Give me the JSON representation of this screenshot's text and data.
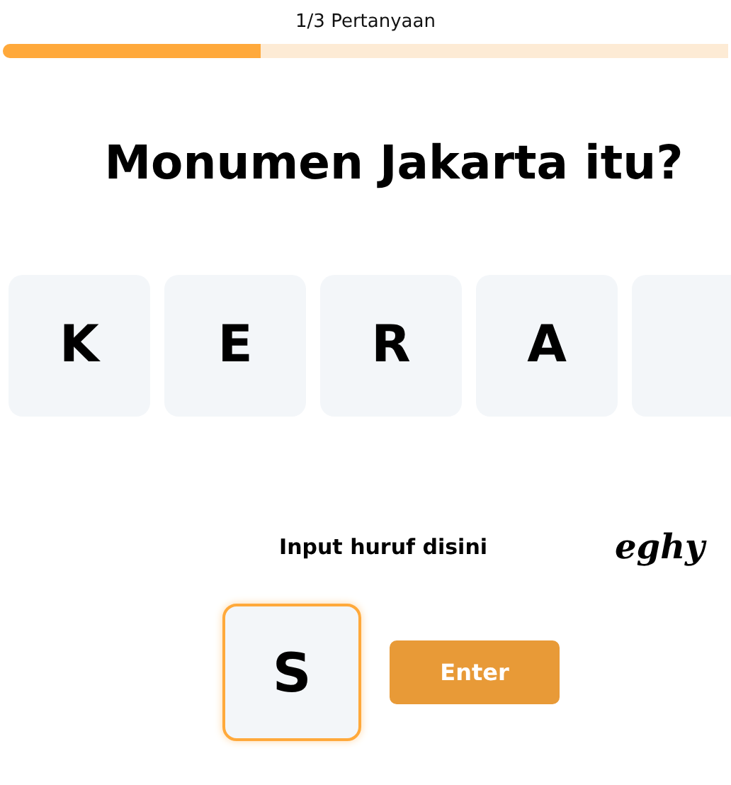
{
  "progress": {
    "label": "1/3 Pertanyaan",
    "level": 0.355
  },
  "question": "Monumen Jakarta itu?",
  "tiles": [
    {
      "kind": "letter",
      "letter": "K"
    },
    {
      "kind": "letter",
      "letter": "E"
    },
    {
      "kind": "letter",
      "letter": "R"
    },
    {
      "kind": "letter",
      "letter": "A"
    },
    {
      "kind": "empty"
    }
  ],
  "input_label": "Input huruf disini",
  "logo": "eghy",
  "input": {
    "value": "S"
  },
  "enter_button": "Enter"
}
